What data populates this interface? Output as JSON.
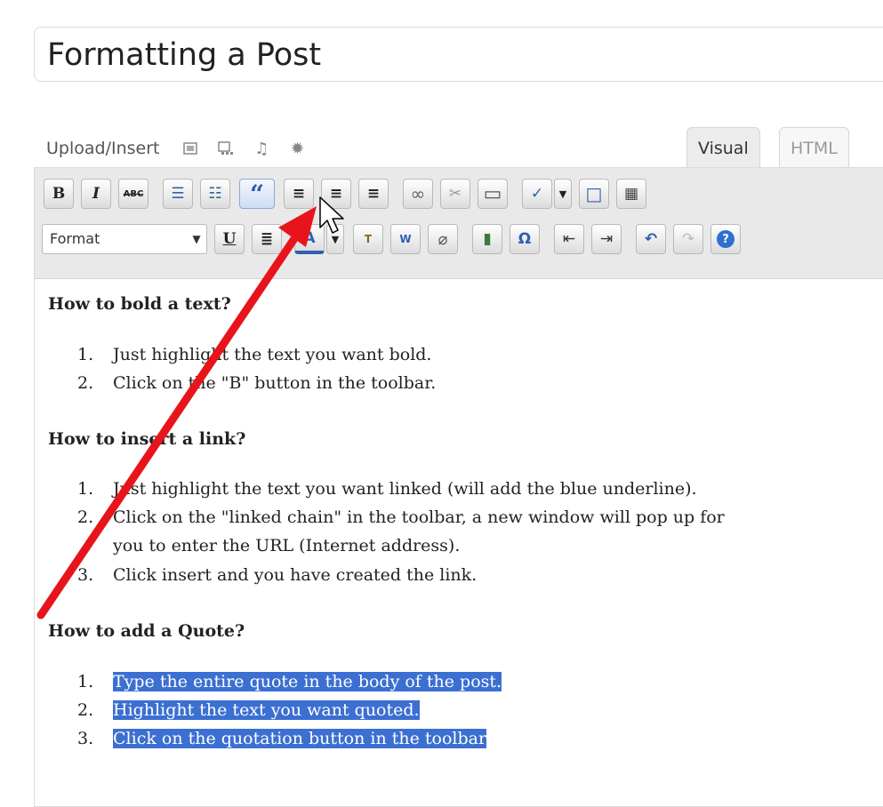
{
  "post": {
    "title": "Formatting a Post"
  },
  "media": {
    "label": "Upload/Insert",
    "icons": [
      "image-icon",
      "gallery-icon",
      "audio-icon",
      "media-burst-icon"
    ]
  },
  "tabs": {
    "visual": "Visual",
    "html": "HTML"
  },
  "toolbar": {
    "row1": [
      {
        "name": "bold-button",
        "glyph": "B"
      },
      {
        "name": "italic-button",
        "glyph": "I"
      },
      {
        "name": "strikethrough-button",
        "glyph": "ABC"
      },
      {
        "name": "bullet-list-button",
        "glyph": "☰"
      },
      {
        "name": "numbered-list-button",
        "glyph": "☷"
      },
      {
        "name": "blockquote-button",
        "glyph": "“"
      },
      {
        "name": "align-left-button",
        "glyph": "≡"
      },
      {
        "name": "align-center-button",
        "glyph": "≡"
      },
      {
        "name": "align-right-button",
        "glyph": "≡"
      },
      {
        "name": "insert-link-button",
        "glyph": "∞"
      },
      {
        "name": "unlink-button",
        "glyph": "✂"
      },
      {
        "name": "more-tag-button",
        "glyph": "▭"
      },
      {
        "name": "spellcheck-button",
        "glyph": "✓"
      },
      {
        "name": "fullscreen-button",
        "glyph": "□"
      },
      {
        "name": "kitchen-sink-button",
        "glyph": "▦"
      }
    ],
    "format_label": "Format",
    "row2": [
      {
        "name": "underline-button",
        "glyph": "U"
      },
      {
        "name": "justify-button",
        "glyph": "≣"
      },
      {
        "name": "text-color-button",
        "glyph": "A"
      },
      {
        "name": "paste-text-button",
        "glyph": "T"
      },
      {
        "name": "paste-word-button",
        "glyph": "W"
      },
      {
        "name": "remove-format-button",
        "glyph": "⌀"
      },
      {
        "name": "insert-media-button",
        "glyph": "▮"
      },
      {
        "name": "special-char-button",
        "glyph": "Ω"
      },
      {
        "name": "outdent-button",
        "glyph": "⇤"
      },
      {
        "name": "indent-button",
        "glyph": "⇥"
      },
      {
        "name": "undo-button",
        "glyph": "↶"
      },
      {
        "name": "redo-button",
        "glyph": "↷"
      },
      {
        "name": "help-button",
        "glyph": "?"
      }
    ]
  },
  "content": {
    "sections": [
      {
        "heading": "How to bold a text?",
        "items": [
          {
            "num": "1.",
            "lines": [
              "Just highlight the text you want bold."
            ]
          },
          {
            "num": "2.",
            "lines": [
              "Click on the \"B\" button in the toolbar."
            ]
          }
        ]
      },
      {
        "heading": "How to insert a link?",
        "items": [
          {
            "num": "1.",
            "lines": [
              "Just highlight the text you want linked (will add the blue underline)."
            ]
          },
          {
            "num": "2.",
            "lines": [
              "Click on the \"linked chain\" in the toolbar, a new window will pop up for",
              "you to enter the URL (Internet address)."
            ]
          },
          {
            "num": "3.",
            "lines": [
              "Click insert and you have created the link."
            ]
          }
        ]
      },
      {
        "heading": "How to add a Quote?",
        "items": [
          {
            "num": "1.",
            "lines": [
              "Type the entire quote in the body of the post."
            ],
            "selected": true
          },
          {
            "num": "2.",
            "lines": [
              "Highlight the text you want quoted."
            ],
            "selected": true
          },
          {
            "num": "3.",
            "lines": [
              "Click on the quotation button in the toolbar"
            ],
            "selected": true
          }
        ]
      }
    ]
  },
  "colors": {
    "annotation_arrow": "#e8141b",
    "selection": "#3b6fd1"
  }
}
